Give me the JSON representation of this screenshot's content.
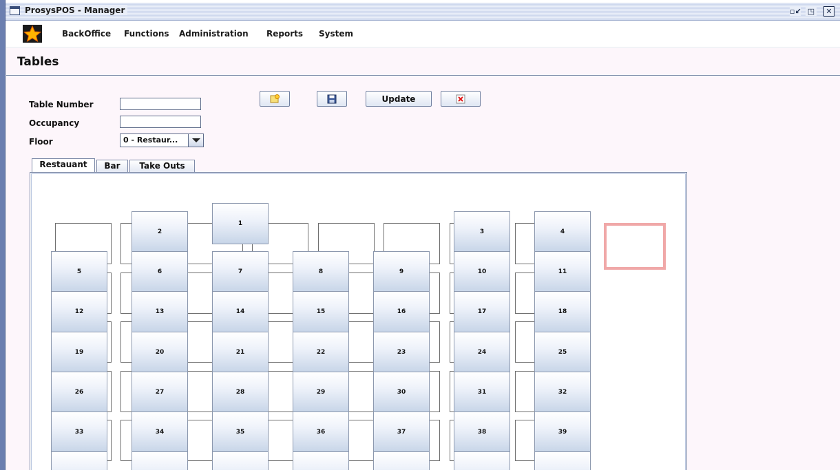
{
  "window": {
    "title": "ProsysPOS - Manager",
    "controls": [
      "minimize-restore",
      "maximize",
      "close"
    ]
  },
  "menu": {
    "items": [
      "BackOffice",
      "Functions",
      "Administration",
      "Reports",
      "System"
    ]
  },
  "page": {
    "title": "Tables"
  },
  "form": {
    "table_number_label": "Table Number",
    "table_number_value": "",
    "occupancy_label": "Occupancy",
    "occupancy_value": "",
    "floor_label": "Floor",
    "floor_value": "0 - Restaur..."
  },
  "toolbar": {
    "new_icon": "new-record-icon",
    "save_icon": "floppy-disk-icon",
    "update_label": "Update",
    "delete_icon": "red-x-delete-icon"
  },
  "tabs": [
    {
      "label": "Restauant",
      "active": true
    },
    {
      "label": "Bar",
      "active": false
    },
    {
      "label": "Take Outs",
      "active": false
    }
  ],
  "tables": [
    "1",
    "2",
    "3",
    "4",
    "5",
    "6",
    "7",
    "8",
    "9",
    "10",
    "11",
    "12",
    "13",
    "14",
    "15",
    "16",
    "17",
    "18",
    "19",
    "20",
    "21",
    "22",
    "23",
    "24",
    "25",
    "26",
    "27",
    "28",
    "29",
    "30",
    "31",
    "32",
    "33",
    "34",
    "35",
    "36",
    "37",
    "38",
    "39"
  ],
  "colors": {
    "title_bar_stripe": "#cfd9ee",
    "window_edge": "#6b7fb0",
    "content_bg": "#fdf6fb",
    "selection_highlight": "#f0a8a8"
  }
}
